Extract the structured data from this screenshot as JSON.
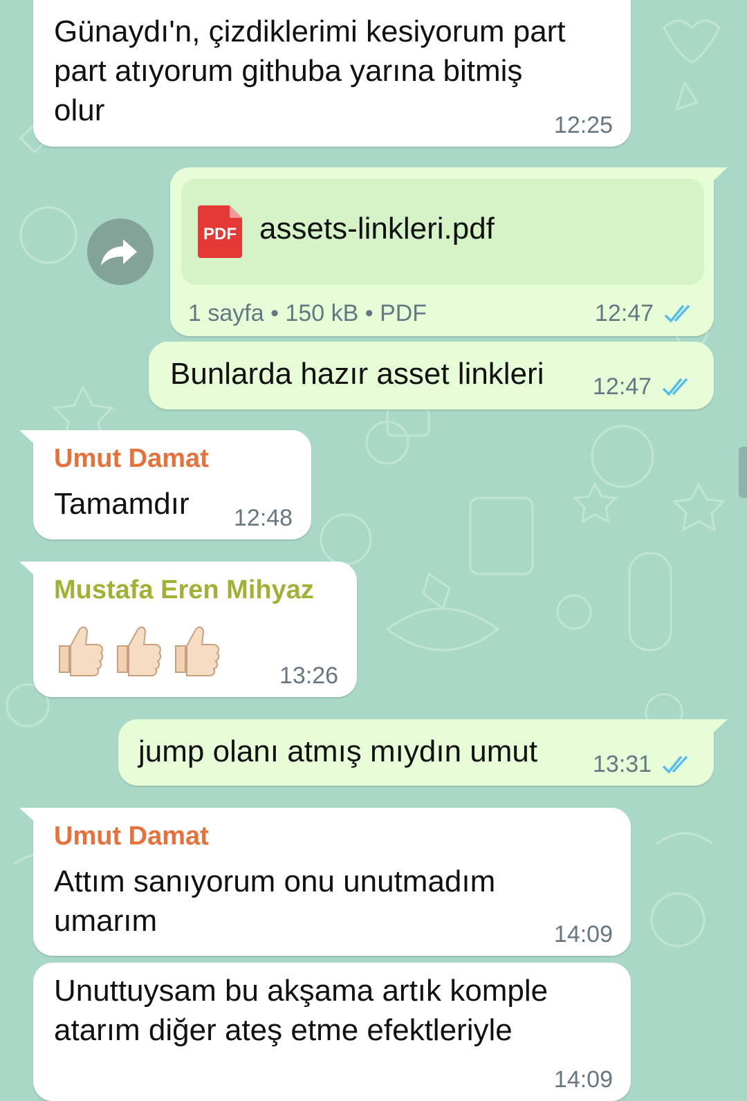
{
  "colors": {
    "chat_background": "#a9d8c6",
    "incoming_bubble": "#ffffff",
    "outgoing_bubble": "#e7fdd8",
    "read_ticks": "#53bdeb",
    "sender_umut": "#e8703a",
    "sender_mustafa": "#a2b136",
    "pdf_badge": "#e53935"
  },
  "messages": [
    {
      "direction": "in",
      "text": "Günaydın, çizdiklerimi kesiyorum part part atıyorum githuba yarına bitmiş olur",
      "line1": "Günaydı'n, çizdiklerimi kesiyorum part",
      "line2": "part atıyorum githuba yarına bitmiş",
      "line3": "olur",
      "time": "12:25"
    },
    {
      "direction": "out",
      "type": "document",
      "file_name": "assets-linkleri.pdf",
      "badge": "PDF",
      "meta": "1 sayfa • 150 kB • PDF",
      "time": "12:47",
      "status": "read",
      "icon": "forward-icon"
    },
    {
      "direction": "out",
      "text": "Bunlarda hazır asset linkleri",
      "time": "12:47",
      "status": "read"
    },
    {
      "direction": "in",
      "sender": "Umut Damat",
      "text": "Tamamdır",
      "time": "12:48"
    },
    {
      "direction": "in",
      "sender": "Mustafa Eren Mihyaz",
      "emoji": "👍🏻👍🏻👍🏻",
      "emoji_name": "thumbs-up",
      "emoji_count": 3,
      "time": "13:26"
    },
    {
      "direction": "out",
      "text": "jump olanı atmış mıydın umut",
      "time": "13:31",
      "status": "read"
    },
    {
      "direction": "in",
      "sender": "Umut Damat",
      "line1": "Attım sanıyorum onu unutmadım",
      "line2": "umarım",
      "time": "14:09"
    },
    {
      "direction": "in",
      "line1": "Unuttuysam bu akşama artık komple",
      "line2": "atarım diğer ateş etme efektleriyle",
      "time": "14:09"
    }
  ]
}
